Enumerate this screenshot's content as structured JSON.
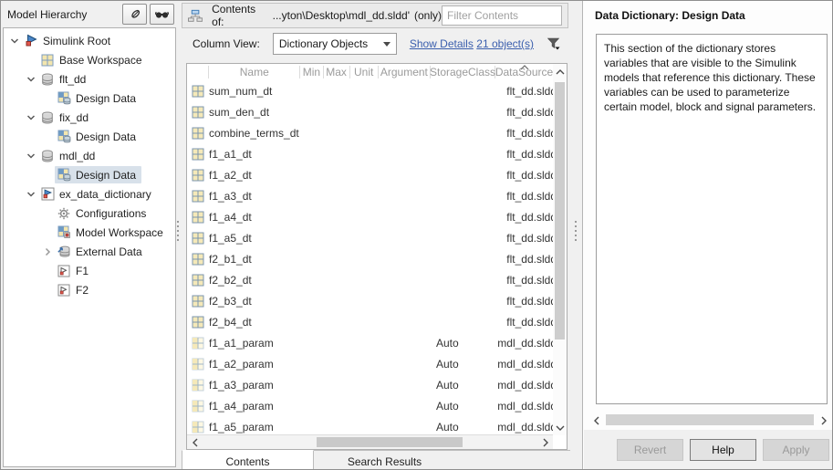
{
  "colors": {
    "link_blue": "#3a5ead",
    "selection": "#d8e1ea",
    "icon_yellow": "#f3e6ae",
    "icon_blue_border": "#7c9cc0",
    "simulink_blue": "#4a86c8",
    "accent_red": "#d9534f",
    "window_bg": "#f0f0f0"
  },
  "left_panel": {
    "title": "Model Hierarchy",
    "toolbar_icons": [
      "pencil-icon",
      "glasses-icon"
    ],
    "tree": [
      {
        "label": "Simulink Root",
        "icon": "simulink-root",
        "level": 0,
        "chevron": "down",
        "selected": false
      },
      {
        "label": "Base Workspace",
        "icon": "workspace-grid",
        "level": 1,
        "chevron": "none",
        "selected": false
      },
      {
        "label": "flt_dd",
        "icon": "database",
        "level": 1,
        "chevron": "down",
        "selected": false
      },
      {
        "label": "Design Data",
        "icon": "design-data",
        "level": 2,
        "chevron": "none",
        "selected": false
      },
      {
        "label": "fix_dd",
        "icon": "database",
        "level": 1,
        "chevron": "down",
        "selected": false
      },
      {
        "label": "Design Data",
        "icon": "design-data",
        "level": 2,
        "chevron": "none",
        "selected": false
      },
      {
        "label": "mdl_dd",
        "icon": "database",
        "level": 1,
        "chevron": "down",
        "selected": false
      },
      {
        "label": "Design Data",
        "icon": "design-data",
        "level": 2,
        "chevron": "none",
        "selected": true
      },
      {
        "label": "ex_data_dictionary",
        "icon": "dictionary-model",
        "level": 1,
        "chevron": "down",
        "selected": false
      },
      {
        "label": "Configurations",
        "icon": "gear",
        "level": 2,
        "chevron": "none",
        "selected": false
      },
      {
        "label": "Model Workspace",
        "icon": "model-workspace",
        "level": 2,
        "chevron": "none",
        "selected": false
      },
      {
        "label": "External Data",
        "icon": "external-data",
        "level": 2,
        "chevron": "right",
        "selected": false
      },
      {
        "label": "F1",
        "icon": "model-block",
        "level": 2,
        "chevron": "none",
        "selected": false
      },
      {
        "label": "F2",
        "icon": "model-block",
        "level": 2,
        "chevron": "none",
        "selected": false
      }
    ]
  },
  "content_panel": {
    "contents_bar": {
      "icon": "hierarchy-icon",
      "label": "Contents of:",
      "path": "...yton\\Desktop\\mdl_dd.sldd'",
      "suffix": "(only)",
      "filter_placeholder": "Filter Contents"
    },
    "column_view": {
      "label": "Column View:",
      "selected_value": "Dictionary Objects",
      "show_details_link": "Show Details",
      "object_count_link": "21 object(s)",
      "filter_icon": "funnel-icon"
    },
    "table": {
      "columns": [
        "Name",
        "Min",
        "Max",
        "Unit",
        "Argument",
        "StorageClass",
        "DataSource"
      ],
      "sorted_column": "DataSource",
      "sort_direction": "ascending",
      "rows": [
        {
          "icon": "grid-dt",
          "name": "sum_num_dt",
          "min": "",
          "max": "",
          "unit": "",
          "argument": "",
          "storage_class": "",
          "data_source": "flt_dd.sldd"
        },
        {
          "icon": "grid-dt",
          "name": "sum_den_dt",
          "min": "",
          "max": "",
          "unit": "",
          "argument": "",
          "storage_class": "",
          "data_source": "flt_dd.sldd"
        },
        {
          "icon": "grid-dt",
          "name": "combine_terms_dt",
          "min": "",
          "max": "",
          "unit": "",
          "argument": "",
          "storage_class": "",
          "data_source": "flt_dd.sldd"
        },
        {
          "icon": "grid-dt",
          "name": "f1_a1_dt",
          "min": "",
          "max": "",
          "unit": "",
          "argument": "",
          "storage_class": "",
          "data_source": "flt_dd.sldd"
        },
        {
          "icon": "grid-dt",
          "name": "f1_a2_dt",
          "min": "",
          "max": "",
          "unit": "",
          "argument": "",
          "storage_class": "",
          "data_source": "flt_dd.sldd"
        },
        {
          "icon": "grid-dt",
          "name": "f1_a3_dt",
          "min": "",
          "max": "",
          "unit": "",
          "argument": "",
          "storage_class": "",
          "data_source": "flt_dd.sldd"
        },
        {
          "icon": "grid-dt",
          "name": "f1_a4_dt",
          "min": "",
          "max": "",
          "unit": "",
          "argument": "",
          "storage_class": "",
          "data_source": "flt_dd.sldd"
        },
        {
          "icon": "grid-dt",
          "name": "f1_a5_dt",
          "min": "",
          "max": "",
          "unit": "",
          "argument": "",
          "storage_class": "",
          "data_source": "flt_dd.sldd"
        },
        {
          "icon": "grid-dt",
          "name": "f2_b1_dt",
          "min": "",
          "max": "",
          "unit": "",
          "argument": "",
          "storage_class": "",
          "data_source": "flt_dd.sldd"
        },
        {
          "icon": "grid-dt",
          "name": "f2_b2_dt",
          "min": "",
          "max": "",
          "unit": "",
          "argument": "",
          "storage_class": "",
          "data_source": "flt_dd.sldd"
        },
        {
          "icon": "grid-dt",
          "name": "f2_b3_dt",
          "min": "",
          "max": "",
          "unit": "",
          "argument": "",
          "storage_class": "",
          "data_source": "flt_dd.sldd"
        },
        {
          "icon": "grid-dt",
          "name": "f2_b4_dt",
          "min": "",
          "max": "",
          "unit": "",
          "argument": "",
          "storage_class": "",
          "data_source": "flt_dd.sldd"
        },
        {
          "icon": "grid-param",
          "name": "f1_a1_param",
          "min": "",
          "max": "",
          "unit": "",
          "argument": "",
          "storage_class": "Auto",
          "data_source": "mdl_dd.sldd"
        },
        {
          "icon": "grid-param",
          "name": "f1_a2_param",
          "min": "",
          "max": "",
          "unit": "",
          "argument": "",
          "storage_class": "Auto",
          "data_source": "mdl_dd.sldd"
        },
        {
          "icon": "grid-param",
          "name": "f1_a3_param",
          "min": "",
          "max": "",
          "unit": "",
          "argument": "",
          "storage_class": "Auto",
          "data_source": "mdl_dd.sldd"
        },
        {
          "icon": "grid-param",
          "name": "f1_a4_param",
          "min": "",
          "max": "",
          "unit": "",
          "argument": "",
          "storage_class": "Auto",
          "data_source": "mdl_dd.sldd"
        },
        {
          "icon": "grid-param",
          "name": "f1_a5_param",
          "min": "",
          "max": "",
          "unit": "",
          "argument": "",
          "storage_class": "Auto",
          "data_source": "mdl_dd.sldd"
        }
      ]
    },
    "tabs": [
      {
        "label": "Contents",
        "active": true
      },
      {
        "label": "Search Results",
        "active": false
      }
    ]
  },
  "right_panel": {
    "title": "Data Dictionary: Design Data",
    "description": "This section of the dictionary stores variables that are visible to the Simulink models that reference this dictionary. These variables can be used to parameterize certain model, block and signal parameters.",
    "buttons": [
      {
        "label": "Revert",
        "enabled": false
      },
      {
        "label": "Help",
        "enabled": true
      },
      {
        "label": "Apply",
        "enabled": false
      }
    ]
  }
}
